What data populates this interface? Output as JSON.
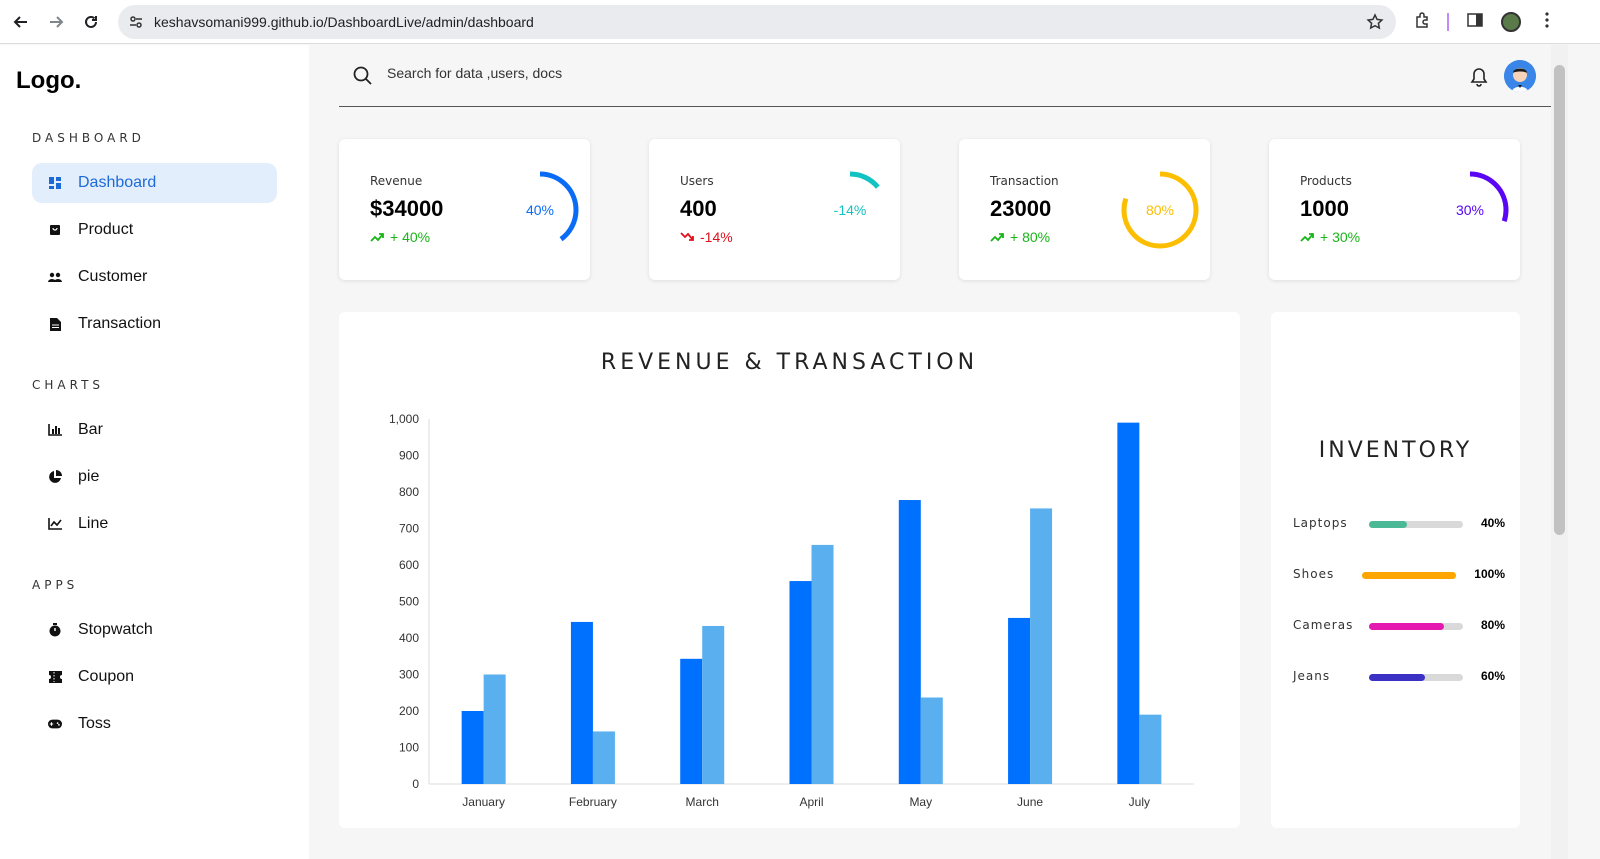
{
  "browser": {
    "url": "keshavsomani999.github.io/DashboardLive/admin/dashboard"
  },
  "sidebar": {
    "logo": "Logo.",
    "sections": [
      {
        "title": "DASHBOARD",
        "items": [
          {
            "label": "Dashboard",
            "icon": "dashboard-icon",
            "active": true
          },
          {
            "label": "Product",
            "icon": "bag-icon"
          },
          {
            "label": "Customer",
            "icon": "people-icon"
          },
          {
            "label": "Transaction",
            "icon": "document-icon"
          }
        ]
      },
      {
        "title": "CHARTS",
        "items": [
          {
            "label": "Bar",
            "icon": "bar-chart-icon"
          },
          {
            "label": "pie",
            "icon": "pie-chart-icon"
          },
          {
            "label": "Line",
            "icon": "line-chart-icon"
          }
        ]
      },
      {
        "title": "APPS",
        "items": [
          {
            "label": "Stopwatch",
            "icon": "stopwatch-icon"
          },
          {
            "label": "Coupon",
            "icon": "coupon-icon"
          },
          {
            "label": "Toss",
            "icon": "gamepad-icon"
          }
        ]
      }
    ]
  },
  "search": {
    "placeholder": "Search for data ,users, docs"
  },
  "stats": [
    {
      "label": "Revenue",
      "value": "$34000",
      "change": "+ 40%",
      "trend": "up",
      "ring_text": "40%",
      "percent": 40,
      "color": "#0a6cf5"
    },
    {
      "label": "Users",
      "value": "400",
      "change": "-14%",
      "trend": "down",
      "ring_text": "-14%",
      "percent": 14,
      "color": "#13c2c2"
    },
    {
      "label": "Transaction",
      "value": "23000",
      "change": "+ 80%",
      "trend": "up",
      "ring_text": "80%",
      "percent": 80,
      "color": "#fcbe00"
    },
    {
      "label": "Products",
      "value": "1000",
      "change": "+ 30%",
      "trend": "up",
      "ring_text": "30%",
      "percent": 30,
      "color": "#5a06f5"
    }
  ],
  "colors": {
    "up": "#19b519",
    "down": "#e0101d",
    "primary": "#1c6ad7"
  },
  "chart_data": {
    "type": "bar",
    "title": "REVENUE & TRANSACTION",
    "categories": [
      "January",
      "February",
      "March",
      "April",
      "May",
      "June",
      "July"
    ],
    "series": [
      {
        "values": [
          200,
          444,
          343,
          556,
          778,
          455,
          990
        ],
        "color": "#0070ff"
      },
      {
        "values": [
          300,
          144,
          433,
          655,
          237,
          755,
          190
        ],
        "color": "#5ab0ee"
      }
    ],
    "ylim": [
      0,
      1000
    ],
    "yticks": [
      "0",
      "100",
      "200",
      "300",
      "400",
      "500",
      "600",
      "700",
      "800",
      "900",
      "1,000"
    ]
  },
  "inventory": {
    "title": "INVENTORY",
    "items": [
      {
        "label": "Laptops",
        "percent_text": "40%",
        "percent": 40,
        "color": "#4bb995"
      },
      {
        "label": "Shoes",
        "percent_text": "100%",
        "percent": 100,
        "color": "#ffa500"
      },
      {
        "label": "Cameras",
        "percent_text": "80%",
        "percent": 80,
        "color": "#e41ab0"
      },
      {
        "label": "Jeans",
        "percent_text": "60%",
        "percent": 60,
        "color": "#3b32c5"
      }
    ]
  }
}
